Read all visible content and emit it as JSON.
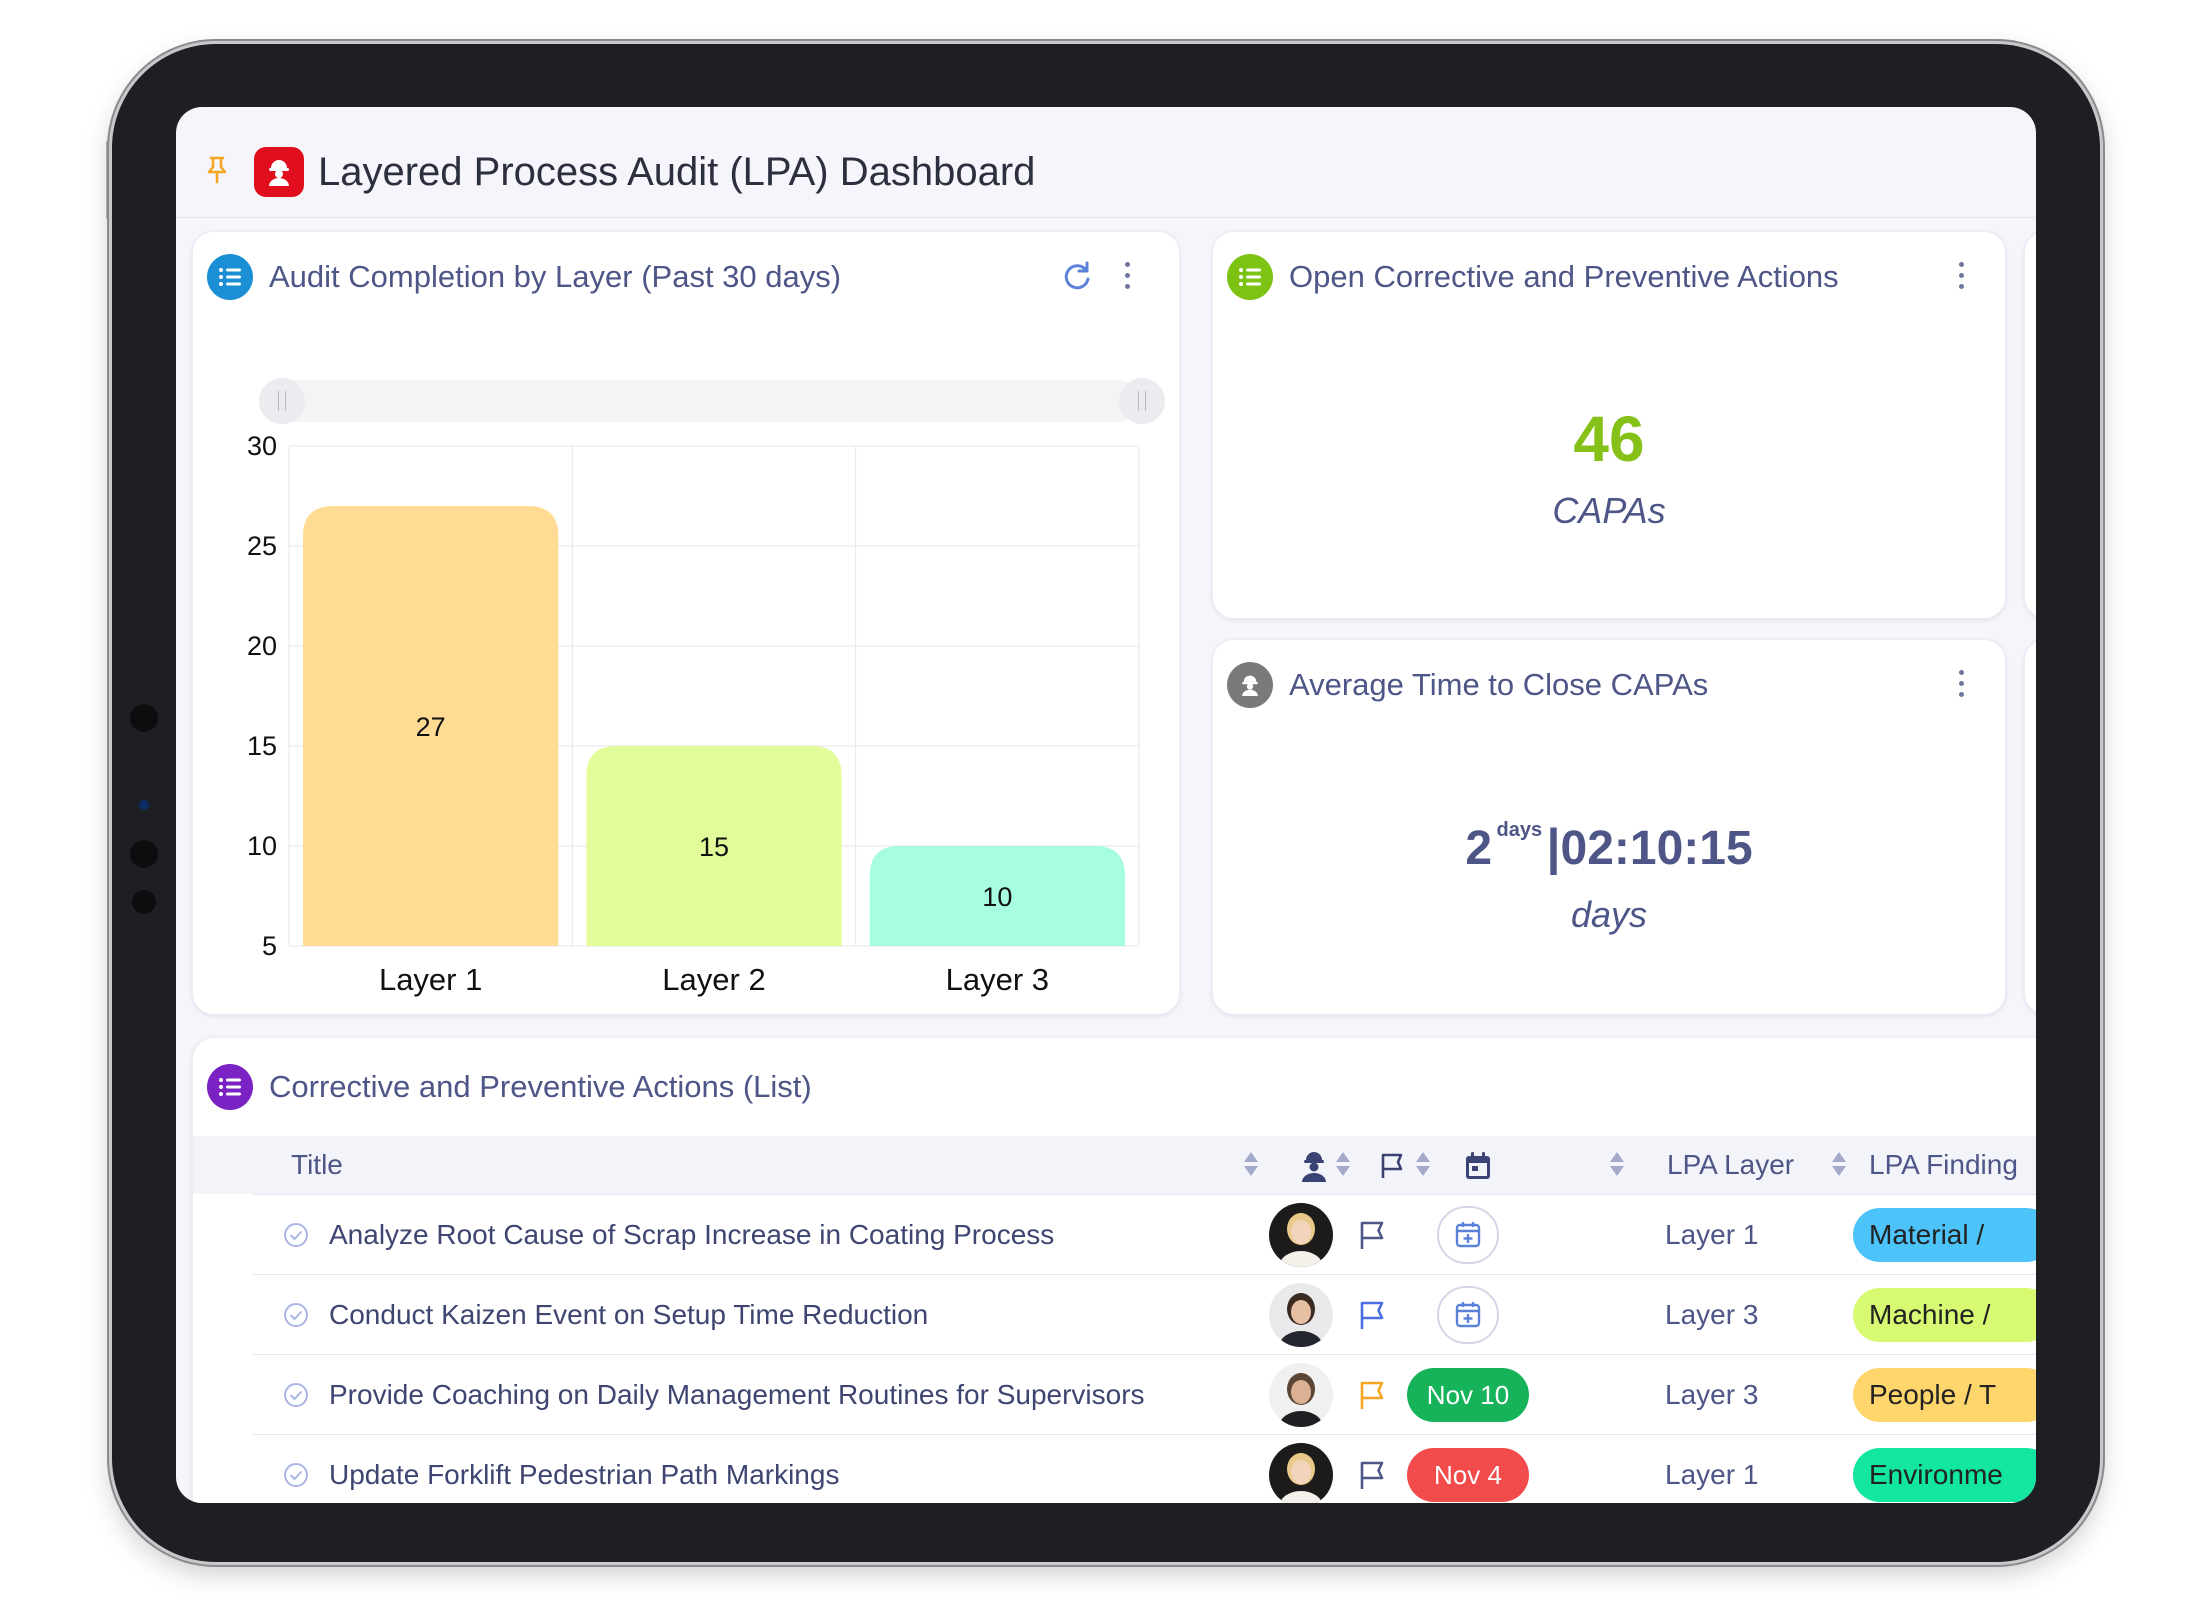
{
  "header": {
    "title": "Layered Process Audit (LPA) Dashboard",
    "pin_icon": "pin-icon",
    "logo_icon": "worker-icon",
    "logo_color": "#e10e1d"
  },
  "audit_card": {
    "title": "Audit Completion by Layer (Past 30 days)",
    "icon": "list-icon",
    "icon_color": "#1a8fd6",
    "refresh_icon": "refresh-icon",
    "menu_icon": "kebab-menu-icon"
  },
  "chart_data": {
    "type": "bar",
    "title": "Audit Completion by Layer (Past 30 days)",
    "categories": [
      "Layer 1",
      "Layer 2",
      "Layer 3"
    ],
    "values": [
      27,
      15,
      10
    ],
    "data_labels": [
      "27",
      "15",
      "10"
    ],
    "colors": [
      "#ffdb94",
      "#e2fc9a",
      "#a6fde0"
    ],
    "ylim": [
      5,
      30
    ],
    "yticks": [
      5,
      10,
      15,
      20,
      25,
      30
    ],
    "ytick_labels": [
      "5",
      "10",
      "15",
      "20",
      "25",
      "30"
    ],
    "grid": true,
    "xlabel": "",
    "ylabel": ""
  },
  "capa_card": {
    "title": "Open Corrective and Preventive Actions",
    "icon": "list-icon",
    "icon_color": "#7cc313",
    "value": "46",
    "value_color": "#86c11a",
    "label": "CAPAs"
  },
  "time_card": {
    "title": "Average Time to Close CAPAs",
    "icon": "worker-icon",
    "icon_color": "#7a7a7a",
    "days_value": "2",
    "days_unit": "days",
    "separator": "|",
    "time_value": "02:10:15",
    "label": "days"
  },
  "list_card": {
    "title": "Corrective and Preventive Actions (List)",
    "icon": "list-icon",
    "icon_color": "#7a22c4",
    "columns": {
      "title": "Title",
      "assignee_icon": "person-icon",
      "priority_icon": "flag-icon",
      "date_icon": "calendar-icon",
      "layer": "LPA Layer",
      "finding": "LPA Finding"
    },
    "rows": [
      {
        "title": "Analyze Root Cause of Scrap Increase in Coating Process",
        "avatar": "avatar-woman",
        "flag_color": "#4e5687",
        "date": "",
        "date_color": "",
        "layer": "Layer 1",
        "finding": "Material / ",
        "finding_color": "#4cc4fa"
      },
      {
        "title": "Conduct Kaizen Event on Setup Time Reduction",
        "avatar": "avatar-man",
        "flag_color": "#4a6ee0",
        "date": "",
        "date_color": "",
        "layer": "Layer 3",
        "finding": "Machine / ",
        "finding_color": "#d8fa72"
      },
      {
        "title": "Provide Coaching on Daily Management Routines for Supervisors",
        "avatar": "avatar-man-bearded",
        "flag_color": "#f5a623",
        "date": "Nov 10",
        "date_color": "#16b35a",
        "layer": "Layer 3",
        "finding": "People / T",
        "finding_color": "#ffd66b"
      },
      {
        "title": "Update Forklift Pedestrian Path Markings",
        "avatar": "avatar-woman",
        "flag_color": "#4e5687",
        "date": "Nov 4",
        "date_color": "#f24b4b",
        "layer": "Layer 1",
        "finding": "Environme",
        "finding_color": "#12e6a0"
      }
    ]
  }
}
